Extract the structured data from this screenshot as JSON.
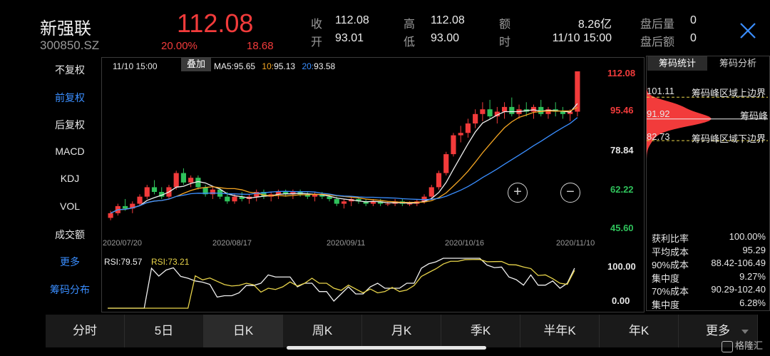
{
  "stock": {
    "name": "新强联",
    "code": "300850.SZ",
    "price": "112.08",
    "change_pct": "20.00%",
    "change_amt": "18.68"
  },
  "quote": {
    "close_label": "收",
    "close": "112.08",
    "open_label": "开",
    "open": "93.01",
    "high_label": "高",
    "high": "112.08",
    "low_label": "低",
    "low": "93.00",
    "amount_label": "额",
    "amount": "8.26亿",
    "time_label": "时",
    "time": "11/10 15:00",
    "after_vol_label": "盘后量",
    "after_vol": "0",
    "after_amt_label": "盘后额",
    "after_amt": "0"
  },
  "left_menu": [
    {
      "label": "不复权",
      "active": false
    },
    {
      "label": "前复权",
      "active": true
    },
    {
      "label": "后复权",
      "active": false
    },
    {
      "label": "MACD",
      "active": false
    },
    {
      "label": "KDJ",
      "active": false
    },
    {
      "label": "VOL",
      "active": false
    },
    {
      "label": "成交额",
      "active": false
    },
    {
      "label": "更多",
      "active": true
    },
    {
      "label": "筹码分布",
      "active": true
    }
  ],
  "chart_header": {
    "time": "11/10 15:00",
    "overlay_button": "叠加",
    "ma5_label": "MA5:",
    "ma5": "95.65",
    "ma10_label": "10:",
    "ma10": "95.13",
    "ma20_label": "20:",
    "ma20": "93.58"
  },
  "price_axis": [
    "112.08",
    "95.46",
    "78.84",
    "62.22",
    "45.60"
  ],
  "date_axis": [
    "2020/07/20",
    "2020/08/17",
    "2020/09/11",
    "2020/10/16",
    "2020/11/10"
  ],
  "zoom": {
    "in": "+",
    "out": "−"
  },
  "rsi": {
    "label1": "RSI:79.57",
    "label2": "RSI:73.21",
    "axis_top": "100.00",
    "axis_bottom": "0.00"
  },
  "chip_panel": {
    "tab1": "筹码统计",
    "tab2": "筹码分析",
    "upper_value": "101.11",
    "upper_label": "筹码峰区域上边界",
    "peak_value": "91.92",
    "peak_label": "筹码峰",
    "lower_value": "82.73",
    "lower_label": "筹码峰区域下边界",
    "stats": [
      {
        "label": "获利比率",
        "value": "100.00%"
      },
      {
        "label": "平均成本",
        "value": "95.29"
      },
      {
        "label": "90%成本",
        "value": "88.42-106.49"
      },
      {
        "label": "集中度",
        "value": "9.27%"
      },
      {
        "label": "70%成本",
        "value": "90.29-102.40"
      },
      {
        "label": "集中度",
        "value": "6.28%"
      }
    ]
  },
  "bottom_tabs": [
    "分时",
    "5日",
    "日K",
    "周K",
    "月K",
    "季K",
    "半年K",
    "年K",
    "更多"
  ],
  "active_tab": "日K",
  "watermark": "格隆汇",
  "colors": {
    "up": "#f23b3b",
    "down": "#2fc25b",
    "ma5": "#f0f0f0",
    "ma10": "#f5a623",
    "ma20": "#3a8eff",
    "accent": "#3a8eff"
  },
  "chart_data": {
    "type": "candlestick",
    "ylim": [
      45.6,
      112.08
    ],
    "x_ticks": [
      "2020/07/20",
      "2020/08/17",
      "2020/09/11",
      "2020/10/16",
      "2020/11/10"
    ],
    "candles": [
      [
        50,
        53,
        49,
        52
      ],
      [
        52,
        56,
        51,
        55
      ],
      [
        55,
        58,
        53,
        54
      ],
      [
        54,
        57,
        52,
        56
      ],
      [
        56,
        60,
        55,
        59
      ],
      [
        59,
        64,
        58,
        63
      ],
      [
        63,
        66,
        60,
        61
      ],
      [
        61,
        63,
        58,
        59
      ],
      [
        59,
        64,
        58,
        63
      ],
      [
        63,
        70,
        62,
        69
      ],
      [
        69,
        71,
        64,
        65
      ],
      [
        65,
        68,
        63,
        67
      ],
      [
        67,
        68,
        62,
        63
      ],
      [
        63,
        64,
        59,
        60
      ],
      [
        60,
        63,
        58,
        62
      ],
      [
        62,
        63,
        58,
        59
      ],
      [
        59,
        61,
        56,
        57
      ],
      [
        57,
        60,
        56,
        59
      ],
      [
        59,
        61,
        57,
        58
      ],
      [
        58,
        60,
        56,
        59
      ],
      [
        59,
        62,
        57,
        61
      ],
      [
        61,
        62,
        58,
        59
      ],
      [
        59,
        61,
        57,
        60
      ],
      [
        60,
        62,
        58,
        61
      ],
      [
        61,
        62,
        59,
        60
      ],
      [
        60,
        62,
        58,
        61
      ],
      [
        61,
        62,
        59,
        60
      ],
      [
        60,
        61,
        58,
        59
      ],
      [
        59,
        61,
        57,
        60
      ],
      [
        60,
        61,
        58,
        59
      ],
      [
        59,
        60,
        57,
        58
      ],
      [
        58,
        59,
        55,
        56
      ],
      [
        56,
        58,
        54,
        57
      ],
      [
        57,
        59,
        55,
        58
      ],
      [
        58,
        59,
        56,
        57
      ],
      [
        57,
        58,
        55,
        56
      ],
      [
        56,
        58,
        55,
        57
      ],
      [
        57,
        58,
        55,
        56
      ],
      [
        56,
        57,
        55,
        56
      ],
      [
        56,
        58,
        55,
        57
      ],
      [
        57,
        58,
        55,
        56
      ],
      [
        56,
        57,
        55,
        56
      ],
      [
        56,
        58,
        55,
        57
      ],
      [
        57,
        60,
        56,
        59
      ],
      [
        59,
        64,
        58,
        63
      ],
      [
        63,
        70,
        62,
        69
      ],
      [
        69,
        78,
        68,
        77
      ],
      [
        77,
        86,
        76,
        85
      ],
      [
        85,
        89,
        82,
        86
      ],
      [
        86,
        92,
        84,
        90
      ],
      [
        90,
        96,
        88,
        94
      ],
      [
        94,
        99,
        91,
        96
      ],
      [
        96,
        100,
        92,
        93
      ],
      [
        93,
        97,
        90,
        95
      ],
      [
        95,
        99,
        92,
        97
      ],
      [
        97,
        101,
        93,
        94
      ],
      [
        94,
        98,
        92,
        96
      ],
      [
        96,
        99,
        93,
        95
      ],
      [
        95,
        98,
        92,
        97
      ],
      [
        97,
        100,
        93,
        94
      ],
      [
        94,
        97,
        92,
        96
      ],
      [
        96,
        99,
        93,
        95
      ],
      [
        95,
        97,
        92,
        94
      ],
      [
        94,
        96,
        91,
        95
      ],
      [
        95,
        112.08,
        93,
        112.08
      ]
    ],
    "rsi": [
      {
        "name": "RSI:79.57",
        "color": "#f0f0f0"
      },
      {
        "name": "RSI:73.21",
        "color": "#e8d44a"
      }
    ]
  }
}
